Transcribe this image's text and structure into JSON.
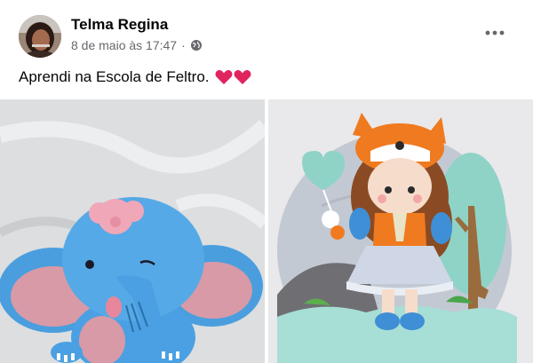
{
  "post": {
    "author": "Telma Regina",
    "timestamp": "8 de maio às 17:47",
    "separator": "·",
    "privacy_icon": "globe-icon",
    "more_icon": "more-options-icon",
    "caption": "Aprendi na Escola de Feltro.",
    "caption_emoji": [
      "red-heart-icon",
      "red-heart-icon"
    ],
    "photos": [
      {
        "subject": "felt-elephant-photo"
      },
      {
        "subject": "felt-fox-doll-photo"
      }
    ]
  },
  "colors": {
    "text_primary": "#050505",
    "text_secondary": "#65676b",
    "heart_red": "#e0245e"
  }
}
